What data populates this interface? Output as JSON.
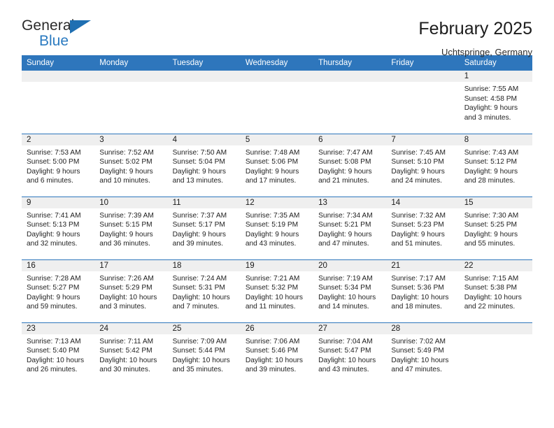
{
  "brand": {
    "name_part1": "General",
    "name_part2": "Blue",
    "triangle_color": "#1f6fb2",
    "blue_text_color": "#2a7ac0"
  },
  "header": {
    "title": "February 2025",
    "subtitle": "Uchtspringe, Germany"
  },
  "theme": {
    "header_blue": "#2e76bc",
    "daynum_band": "#efefef",
    "text": "#1a1a1a"
  },
  "calendar": {
    "weekday_headers": [
      "Sunday",
      "Monday",
      "Tuesday",
      "Wednesday",
      "Thursday",
      "Friday",
      "Saturday"
    ],
    "labels": {
      "sunrise": "Sunrise:",
      "sunset": "Sunset:",
      "daylight": "Daylight:"
    },
    "weeks": [
      [
        {
          "empty": true
        },
        {
          "empty": true
        },
        {
          "empty": true
        },
        {
          "empty": true
        },
        {
          "empty": true
        },
        {
          "empty": true
        },
        {
          "day": "1",
          "sunrise": "Sunrise: 7:55 AM",
          "sunset": "Sunset: 4:58 PM",
          "daylight": "Daylight: 9 hours and 3 minutes."
        }
      ],
      [
        {
          "day": "2",
          "sunrise": "Sunrise: 7:53 AM",
          "sunset": "Sunset: 5:00 PM",
          "daylight": "Daylight: 9 hours and 6 minutes."
        },
        {
          "day": "3",
          "sunrise": "Sunrise: 7:52 AM",
          "sunset": "Sunset: 5:02 PM",
          "daylight": "Daylight: 9 hours and 10 minutes."
        },
        {
          "day": "4",
          "sunrise": "Sunrise: 7:50 AM",
          "sunset": "Sunset: 5:04 PM",
          "daylight": "Daylight: 9 hours and 13 minutes."
        },
        {
          "day": "5",
          "sunrise": "Sunrise: 7:48 AM",
          "sunset": "Sunset: 5:06 PM",
          "daylight": "Daylight: 9 hours and 17 minutes."
        },
        {
          "day": "6",
          "sunrise": "Sunrise: 7:47 AM",
          "sunset": "Sunset: 5:08 PM",
          "daylight": "Daylight: 9 hours and 21 minutes."
        },
        {
          "day": "7",
          "sunrise": "Sunrise: 7:45 AM",
          "sunset": "Sunset: 5:10 PM",
          "daylight": "Daylight: 9 hours and 24 minutes."
        },
        {
          "day": "8",
          "sunrise": "Sunrise: 7:43 AM",
          "sunset": "Sunset: 5:12 PM",
          "daylight": "Daylight: 9 hours and 28 minutes."
        }
      ],
      [
        {
          "day": "9",
          "sunrise": "Sunrise: 7:41 AM",
          "sunset": "Sunset: 5:13 PM",
          "daylight": "Daylight: 9 hours and 32 minutes."
        },
        {
          "day": "10",
          "sunrise": "Sunrise: 7:39 AM",
          "sunset": "Sunset: 5:15 PM",
          "daylight": "Daylight: 9 hours and 36 minutes."
        },
        {
          "day": "11",
          "sunrise": "Sunrise: 7:37 AM",
          "sunset": "Sunset: 5:17 PM",
          "daylight": "Daylight: 9 hours and 39 minutes."
        },
        {
          "day": "12",
          "sunrise": "Sunrise: 7:35 AM",
          "sunset": "Sunset: 5:19 PM",
          "daylight": "Daylight: 9 hours and 43 minutes."
        },
        {
          "day": "13",
          "sunrise": "Sunrise: 7:34 AM",
          "sunset": "Sunset: 5:21 PM",
          "daylight": "Daylight: 9 hours and 47 minutes."
        },
        {
          "day": "14",
          "sunrise": "Sunrise: 7:32 AM",
          "sunset": "Sunset: 5:23 PM",
          "daylight": "Daylight: 9 hours and 51 minutes."
        },
        {
          "day": "15",
          "sunrise": "Sunrise: 7:30 AM",
          "sunset": "Sunset: 5:25 PM",
          "daylight": "Daylight: 9 hours and 55 minutes."
        }
      ],
      [
        {
          "day": "16",
          "sunrise": "Sunrise: 7:28 AM",
          "sunset": "Sunset: 5:27 PM",
          "daylight": "Daylight: 9 hours and 59 minutes."
        },
        {
          "day": "17",
          "sunrise": "Sunrise: 7:26 AM",
          "sunset": "Sunset: 5:29 PM",
          "daylight": "Daylight: 10 hours and 3 minutes."
        },
        {
          "day": "18",
          "sunrise": "Sunrise: 7:24 AM",
          "sunset": "Sunset: 5:31 PM",
          "daylight": "Daylight: 10 hours and 7 minutes."
        },
        {
          "day": "19",
          "sunrise": "Sunrise: 7:21 AM",
          "sunset": "Sunset: 5:32 PM",
          "daylight": "Daylight: 10 hours and 11 minutes."
        },
        {
          "day": "20",
          "sunrise": "Sunrise: 7:19 AM",
          "sunset": "Sunset: 5:34 PM",
          "daylight": "Daylight: 10 hours and 14 minutes."
        },
        {
          "day": "21",
          "sunrise": "Sunrise: 7:17 AM",
          "sunset": "Sunset: 5:36 PM",
          "daylight": "Daylight: 10 hours and 18 minutes."
        },
        {
          "day": "22",
          "sunrise": "Sunrise: 7:15 AM",
          "sunset": "Sunset: 5:38 PM",
          "daylight": "Daylight: 10 hours and 22 minutes."
        }
      ],
      [
        {
          "day": "23",
          "sunrise": "Sunrise: 7:13 AM",
          "sunset": "Sunset: 5:40 PM",
          "daylight": "Daylight: 10 hours and 26 minutes."
        },
        {
          "day": "24",
          "sunrise": "Sunrise: 7:11 AM",
          "sunset": "Sunset: 5:42 PM",
          "daylight": "Daylight: 10 hours and 30 minutes."
        },
        {
          "day": "25",
          "sunrise": "Sunrise: 7:09 AM",
          "sunset": "Sunset: 5:44 PM",
          "daylight": "Daylight: 10 hours and 35 minutes."
        },
        {
          "day": "26",
          "sunrise": "Sunrise: 7:06 AM",
          "sunset": "Sunset: 5:46 PM",
          "daylight": "Daylight: 10 hours and 39 minutes."
        },
        {
          "day": "27",
          "sunrise": "Sunrise: 7:04 AM",
          "sunset": "Sunset: 5:47 PM",
          "daylight": "Daylight: 10 hours and 43 minutes."
        },
        {
          "day": "28",
          "sunrise": "Sunrise: 7:02 AM",
          "sunset": "Sunset: 5:49 PM",
          "daylight": "Daylight: 10 hours and 47 minutes."
        },
        {
          "empty": true
        }
      ]
    ]
  }
}
